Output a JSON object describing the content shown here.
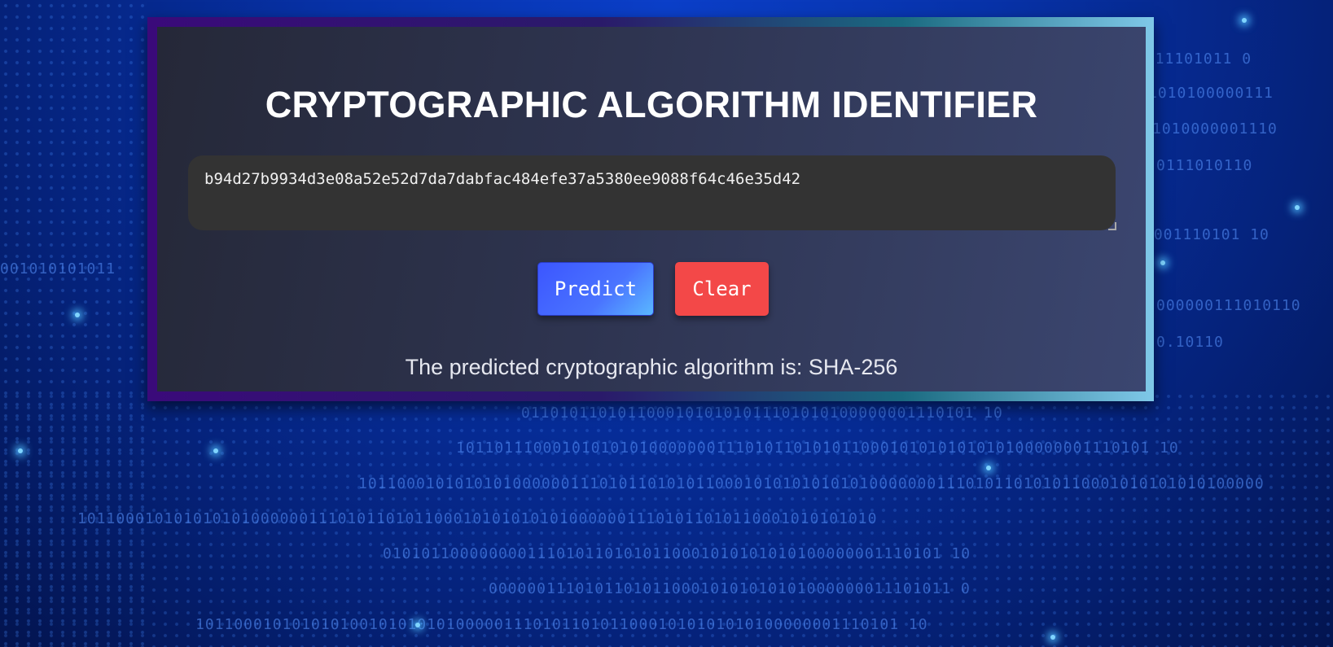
{
  "page": {
    "title": "CRYPTOGRAPHIC ALGORITHM IDENTIFIER"
  },
  "input": {
    "value": "b94d27b9934d3e08a52e52d7da7dabfac484efe37a5380ee9088f64c46e35d42",
    "placeholder": ""
  },
  "buttons": {
    "predict_label": "Predict",
    "clear_label": "Clear"
  },
  "result": {
    "text": "The predicted cryptographic algorithm is: SHA-256"
  },
  "colors": {
    "predict_button": "#3c56ff",
    "clear_button": "#f34848",
    "card_background": "#2e3450",
    "input_background": "#333333"
  }
}
